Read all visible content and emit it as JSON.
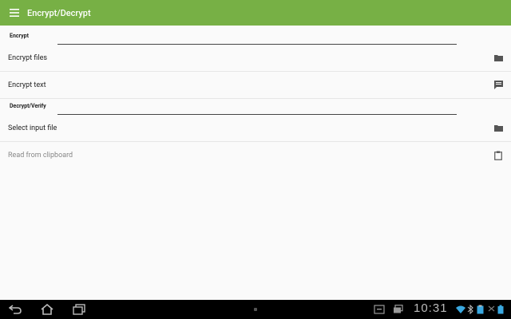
{
  "appbar": {
    "title": "Encrypt/Decrypt",
    "color": "#77b045"
  },
  "sections": [
    {
      "label": "Encrypt",
      "items": [
        {
          "label": "Encrypt files",
          "icon": "folder-icon"
        },
        {
          "label": "Encrypt text",
          "icon": "message-icon"
        }
      ]
    },
    {
      "label": "Decrypt/Verify",
      "items": [
        {
          "label": "Select input file",
          "icon": "folder-icon"
        },
        {
          "label": "Read from clipboard",
          "icon": "clipboard-icon",
          "disabled": true
        }
      ]
    }
  ],
  "status": {
    "time": "10:31"
  }
}
